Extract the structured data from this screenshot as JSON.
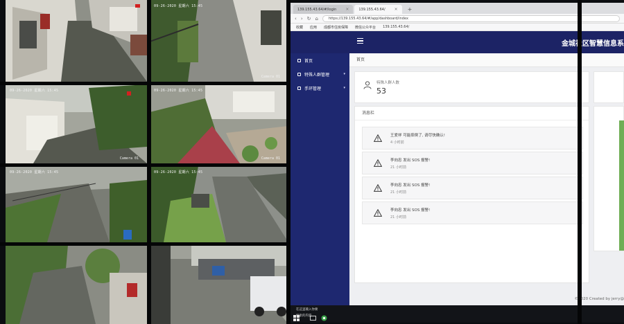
{
  "cameras": [
    {
      "timestamp": "",
      "label": ""
    },
    {
      "timestamp": "09-26-2020 星期六 15:45",
      "label": "Camera 01"
    },
    {
      "timestamp": "09-26-2020 星期六 15:45",
      "label": "Camera 01"
    },
    {
      "timestamp": "09-26-2020 星期六 15:45",
      "label": "Camera 01"
    },
    {
      "timestamp": "09-26-2020 星期六 15:45",
      "label": ""
    },
    {
      "timestamp": "09-26-2020 星期六 15:45",
      "label": ""
    },
    {
      "timestamp": "",
      "label": ""
    },
    {
      "timestamp": "",
      "label": ""
    }
  ],
  "browser": {
    "tabs": [
      {
        "label": "139.155.43.64/#/login"
      },
      {
        "label": "139.155.43.64/"
      }
    ],
    "new_tab": "+",
    "url": "https://139.155.43.64/#/app/dashboard/index",
    "bookmarks": [
      "收藏",
      "应用",
      "成都市住房保障",
      "微信公众平台",
      "139.155.43.64/"
    ]
  },
  "app": {
    "title": "金城社区智慧信息系",
    "menu": [
      {
        "label": "首页",
        "has_caret": false
      },
      {
        "label": "特殊人群管理",
        "has_caret": true
      },
      {
        "label": "手环管理",
        "has_caret": true
      }
    ],
    "breadcrumb": "首页",
    "stat": {
      "label": "特殊人群人数",
      "value": "53"
    },
    "panel_title": "消息栏",
    "messages": [
      {
        "text": "王爱祥 可能摔倒了, 请尽快确认!",
        "time": "4 小时前"
      },
      {
        "text": "李向忠 发出 SOS 报警!",
        "time": "21 小时前"
      },
      {
        "text": "李向忠 发出 SOS 报警!",
        "time": "21 小时前"
      },
      {
        "text": "李向忠 发出 SOS 报警!",
        "time": "21 小时前"
      }
    ],
    "footer": "©2020 Created by jerry@"
  },
  "taskbar": {
    "search": "在这里输入你要搜索的内容"
  },
  "colors": {
    "header": "#1c2365",
    "sidebar": "#1e2870",
    "panel_bg": "#ffffff",
    "message_bg": "#f6f6f7"
  }
}
